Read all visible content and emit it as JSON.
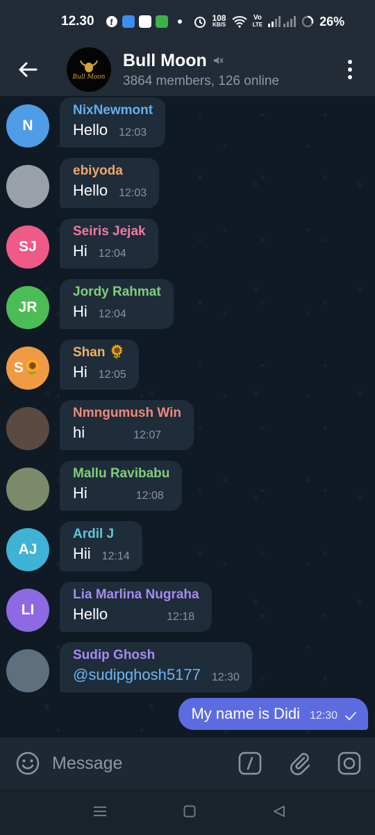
{
  "status_bar": {
    "time": "12.30",
    "network_speed_top": "108",
    "network_speed_unit": "KB/S",
    "volte_top": "Vo",
    "volte_bottom": "LTE",
    "battery": "26%",
    "icons": [
      "facebook-icon",
      "app-icon-blue",
      "app-icon-white",
      "app-icon-green",
      "alarm-icon",
      "wifi-icon",
      "signal-icon",
      "battery-icon"
    ]
  },
  "header": {
    "title": "Bull Moon",
    "subtitle": "3864 members, 126 online",
    "muted": true,
    "avatar_text": "Bull Moon"
  },
  "messages": [
    {
      "sender": "NixNewmont",
      "initials": "N",
      "avatar_color": "#4f9de6",
      "sender_color": "#62b0f0",
      "text": "Hello",
      "time": "12:03"
    },
    {
      "sender": "ebiyoda",
      "initials": "",
      "avatar_color": "#9aa0a8",
      "sender_color": "#eda76b",
      "text": "Hello",
      "time": "12:03"
    },
    {
      "sender": "Seiris Jejak",
      "initials": "SJ",
      "avatar_color": "#ef5a86",
      "sender_color": "#f27ba0",
      "text": "Hi",
      "time": "12:04"
    },
    {
      "sender": "Jordy Rahmat",
      "initials": "JR",
      "avatar_color": "#4cbd55",
      "sender_color": "#7ed07a",
      "text": "Hi",
      "time": "12:04"
    },
    {
      "sender": "Shan 🌻",
      "initials": "S🌻",
      "avatar_color": "#f09a45",
      "sender_color": "#f0b266",
      "text": "Hi",
      "time": "12:05"
    },
    {
      "sender": "Nmngumush Win",
      "initials": "",
      "avatar_color": "#5a4a40",
      "sender_color": "#ef8a7a",
      "text": "hi",
      "time": "12:07"
    },
    {
      "sender": "Mallu Ravibabu",
      "initials": "",
      "avatar_color": "#7d8a6a",
      "sender_color": "#7ed07a",
      "text": "Hi",
      "time": "12:08"
    },
    {
      "sender": "Ardil J",
      "initials": "AJ",
      "avatar_color": "#3fb3d6",
      "sender_color": "#5dc9d8",
      "text": "Hii",
      "time": "12:14"
    },
    {
      "sender": "Lia Marlina Nugraha",
      "initials": "LI",
      "avatar_color": "#8d6ae3",
      "sender_color": "#a58cf0",
      "text": "Hello",
      "time": "12:18"
    },
    {
      "sender": "Sudip Ghosh",
      "initials": "",
      "avatar_color": "#5e6f7e",
      "sender_color": "#a58cf0",
      "text": "@sudipghosh5177",
      "time": "12:30",
      "mention": true
    }
  ],
  "outgoing": {
    "text": "My name is Didi",
    "time": "12:30",
    "status": "sent"
  },
  "input": {
    "placeholder": "Message"
  },
  "colors": {
    "background": "#0e1621",
    "header": "#222b36",
    "bubble_in": "#1f2c3a",
    "bubble_out": "#5d6be0",
    "accent": "#62b0f0"
  }
}
